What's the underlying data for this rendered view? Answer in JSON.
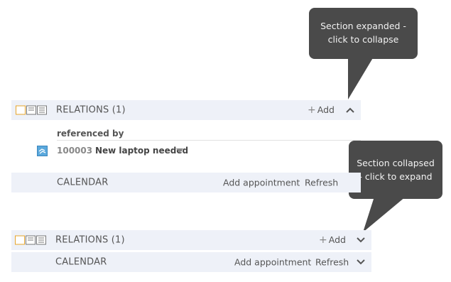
{
  "callouts": {
    "expanded": {
      "line1": "Section expanded -",
      "line2": "click to collapse"
    },
    "collapsed": {
      "line1": "Section collapsed",
      "line2": "- click to expand"
    }
  },
  "expanded_section": {
    "relations_title": "RELATIONS (1)",
    "add_label": "Add",
    "referenced_by_label": "referenced by",
    "item": {
      "id": "100003",
      "title": "New laptop needed"
    },
    "calendar": {
      "title": "CALENDAR",
      "add_appointment_label": "Add appointment",
      "refresh_label": "Refresh"
    }
  },
  "collapsed_section": {
    "relations_title": "RELATIONS (1)",
    "add_label": "Add",
    "calendar": {
      "title": "CALENDAR",
      "add_appointment_label": "Add appointment",
      "refresh_label": "Refresh"
    }
  },
  "icons": {
    "view_icons": [
      "view-mode-1-icon",
      "view-mode-2-icon",
      "view-mode-3-icon"
    ],
    "expand_state_expanded": "chevron-up-icon",
    "expand_state_collapsed": "chevron-down-icon",
    "item_type": "ticket-icon"
  },
  "colors": {
    "bar_background": "#eef1f8",
    "callout_background": "#4a4a4a",
    "accent_orange": "#e7a52a",
    "item_icon": "#4a9fd8"
  }
}
